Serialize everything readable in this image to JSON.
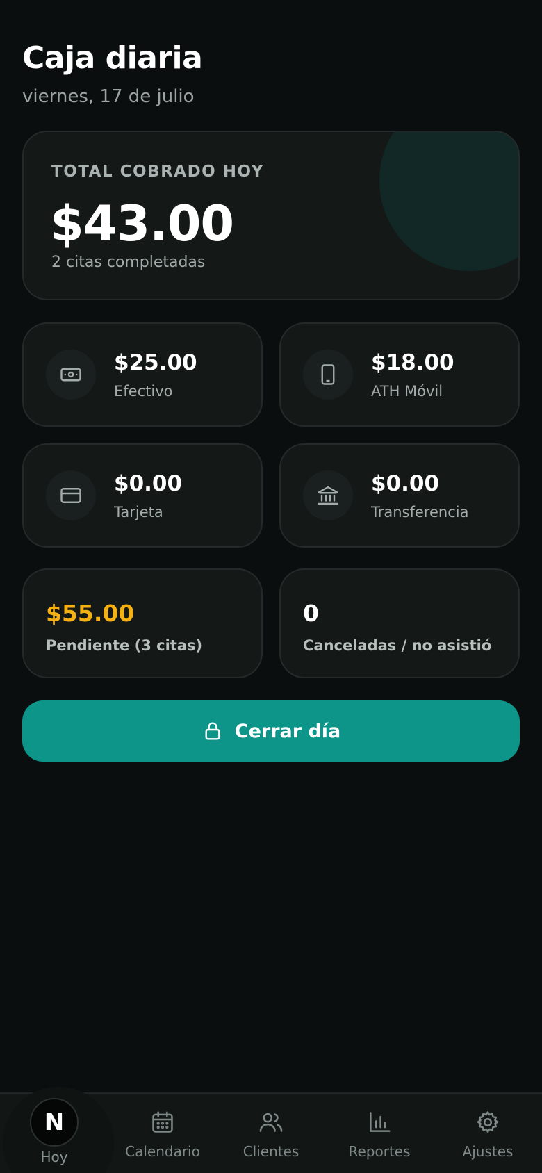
{
  "header": {
    "title": "Caja diaria",
    "date": "viernes, 17 de julio"
  },
  "total": {
    "label": "TOTAL COBRADO HOY",
    "amount": "$43.00",
    "subtitle": "2 citas completadas"
  },
  "methods": [
    {
      "amount": "$25.00",
      "label": "Efectivo",
      "icon": "cash-icon"
    },
    {
      "amount": "$18.00",
      "label": "ATH Móvil",
      "icon": "phone-icon"
    },
    {
      "amount": "$0.00",
      "label": "Tarjeta",
      "icon": "credit-card-icon"
    },
    {
      "amount": "$0.00",
      "label": "Transferencia",
      "icon": "bank-icon"
    }
  ],
  "stats": {
    "pending": {
      "amount": "$55.00",
      "label": "Pendiente (3 citas)"
    },
    "cancelled": {
      "amount": "0",
      "label": "Canceladas / no asistió"
    }
  },
  "actions": {
    "close_day_label": "Cerrar día"
  },
  "nav": {
    "logo_letter": "N",
    "items": [
      {
        "label": "Hoy",
        "icon": "logo-icon",
        "active": true
      },
      {
        "label": "Calendario",
        "icon": "calendar-icon"
      },
      {
        "label": "Clientes",
        "icon": "users-icon"
      },
      {
        "label": "Reportes",
        "icon": "bar-chart-icon"
      },
      {
        "label": "Ajustes",
        "icon": "gear-icon"
      }
    ]
  },
  "colors": {
    "background": "#0a0e0e",
    "card": "#141918",
    "accent": "#0e958a",
    "pending": "#f5b014"
  }
}
